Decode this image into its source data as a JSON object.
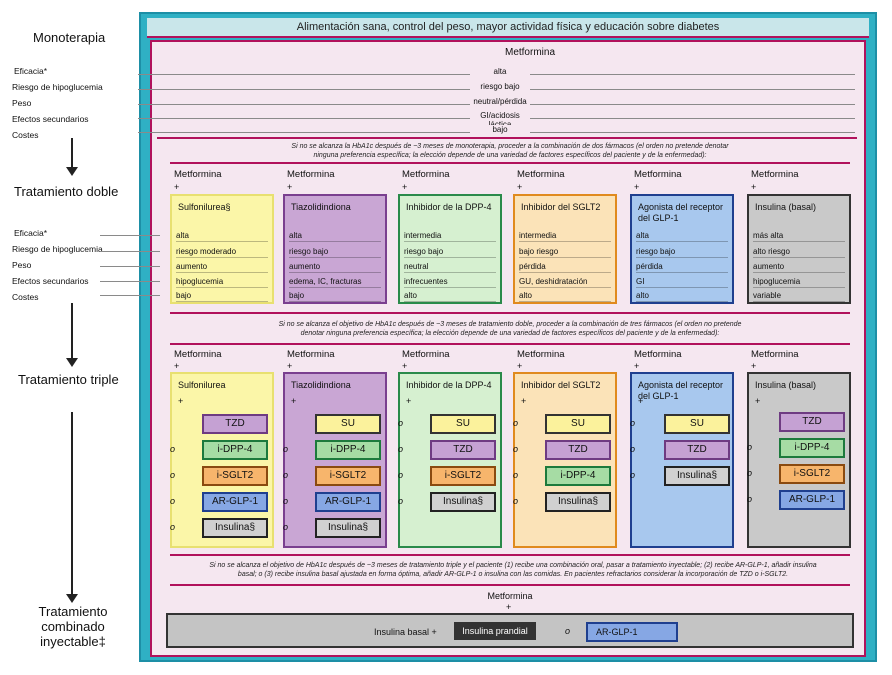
{
  "colors": {
    "teal": "#2fb0c4",
    "magenta": "#b1125c",
    "pink_bg": "#f5e7f0",
    "sulf": "#fbf6a8",
    "tzd": "#c9a6d4",
    "dpp4": "#d6f0d0",
    "sglt2": "#fbe3b8",
    "glp1": "#a8c8ee",
    "ins": "#c9c9c9",
    "badge_tzd": "#c5a1d3",
    "badge_su": "#fbf29c",
    "badge_dpp4": "#a6dca4",
    "badge_sglt2": "#f7b56c",
    "badge_glp1": "#86a7e4",
    "badge_ins": "#d0d0d0",
    "badge_prandial": "#333333"
  },
  "sidebar": {
    "mono": "Monoterapia",
    "mono_labels": [
      "Eficacia*",
      "Riesgo de hipoglucemia",
      "Peso",
      "Efectos secundarios",
      "Costes"
    ],
    "dual": "Tratamiento doble",
    "dual_labels": [
      "Eficacia*",
      "Riesgo de hipoglucemia",
      "Peso",
      "Efectos secundarios",
      "Costes"
    ],
    "triple": "Tratamiento triple",
    "combo": [
      "Tratamiento",
      "combinado",
      "inyectable‡"
    ]
  },
  "title": "Alimentación sana, control del peso, mayor actividad física y educación sobre diabetes",
  "mono": {
    "header": "Metformina",
    "values": [
      "alta",
      "riesgo bajo",
      "neutral/pérdida",
      "GI/acidosis láctica",
      "bajo"
    ],
    "note": [
      "Si no se alcanza la HbA1c después de ~3 meses de monoterapia, proceder a la combinación de dos fármacos (el orden no pretende denotar",
      "ninguna preferencia específica; la elección depende de una variedad de factores específicos del paciente y de la enfermedad):"
    ]
  },
  "metformina": "Metformina",
  "plus": "+",
  "dual": {
    "cards": [
      {
        "title": "Sulfonilurea§",
        "values": [
          "alta",
          "riesgo moderado",
          "aumento",
          "hipoglucemia",
          "bajo"
        ]
      },
      {
        "title": "Tiazolidindiona",
        "values": [
          "alta",
          "riesgo bajo",
          "aumento",
          "edema, IC, fracturas",
          "bajo"
        ]
      },
      {
        "title": "Inhibidor de la DPP-4",
        "values": [
          "intermedia",
          "riesgo bajo",
          "neutral",
          "infrecuentes",
          "alto"
        ]
      },
      {
        "title": "Inhibidor del SGLT2",
        "values": [
          "intermedia",
          "bajo riesgo",
          "pérdida",
          "GU, deshidratación",
          "alto"
        ]
      },
      {
        "title": "Agonista del receptor del GLP-1",
        "values": [
          "alta",
          "riesgo bajo",
          "pérdida",
          "GI",
          "alto"
        ]
      },
      {
        "title": "Insulina (basal)",
        "values": [
          "más alta",
          "alto riesgo",
          "aumento",
          "hipoglucemia",
          "variable"
        ]
      }
    ],
    "note": [
      "Si no se alcanza el objetivo de HbA1c después de ~3 meses de tratamiento doble, proceder a la combinación de tres fármacos (el orden no pretende",
      "denotar ninguna preferencia específica; la elección depende de una variedad de factores específicos del paciente y de la enfermedad):"
    ]
  },
  "triple": {
    "cards": [
      {
        "title": "Sulfonilurea",
        "options": [
          "TZD",
          "i-DPP-4",
          "i-SGLT2",
          "AR-GLP-1",
          "Insulina§"
        ]
      },
      {
        "title": "Tiazolidindiona",
        "options": [
          "SU",
          "i-DPP-4",
          "i-SGLT2",
          "AR-GLP-1",
          "Insulina§"
        ]
      },
      {
        "title": "Inhibidor de la DPP-4",
        "options": [
          "SU",
          "TZD",
          "i-SGLT2",
          "Insulina§"
        ]
      },
      {
        "title": "Inhibidor del SGLT2",
        "options": [
          "SU",
          "TZD",
          "i-DPP-4",
          "Insulina§"
        ]
      },
      {
        "title": "Agonista del receptor del GLP-1",
        "options": [
          "SU",
          "TZD",
          "Insulina§"
        ]
      },
      {
        "title": "Insulina (basal)",
        "options": [
          "TZD",
          "i-DPP-4",
          "i-SGLT2",
          "AR-GLP-1"
        ]
      }
    ],
    "o": "o",
    "note": [
      "Si no se alcanza el objetivo de HbA1c después de ~3 meses de tratamiento triple y el paciente (1) recibe una combinación oral, pasar a tratamiento inyectable; (2) recibe AR-GLP-1, añadir insulina",
      "basal; o (3) recibe insulina basal ajustada en forma óptima, añadir AR-GLP-1 o insulina con las comidas. En pacientes refractarios considerar la incorporación de TZD o i-SGLT2."
    ]
  },
  "combo": {
    "header": "Metformina",
    "plus": "+",
    "basal": "Insulina basal +",
    "prandial": "Insulina prandial",
    "o": "o",
    "glp1": "AR-GLP-1"
  }
}
